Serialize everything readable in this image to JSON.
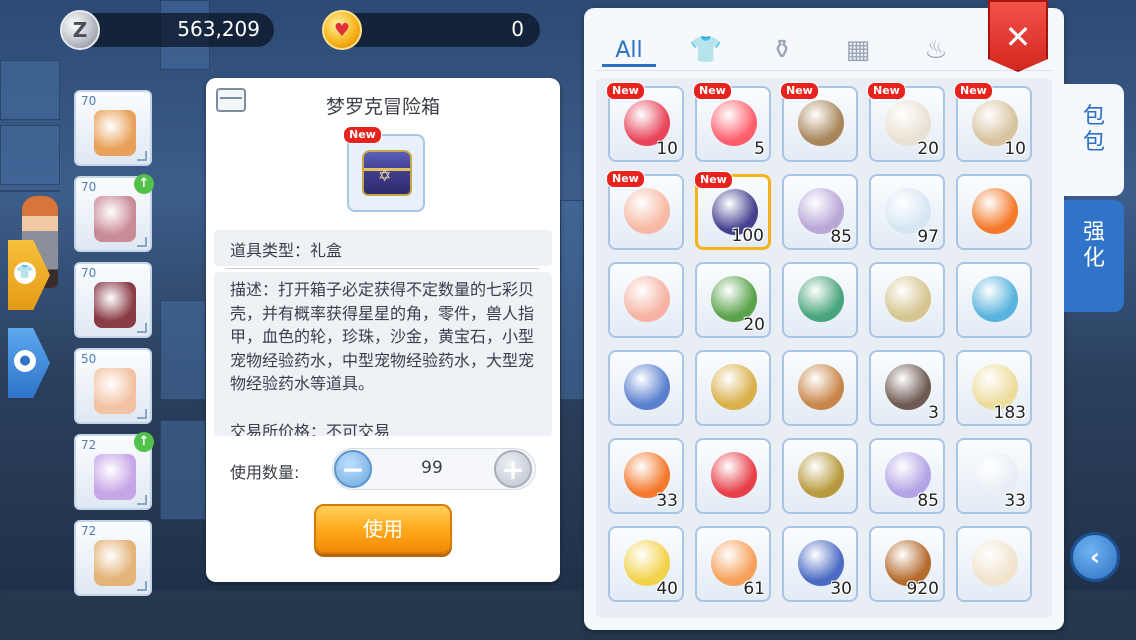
{
  "currency": {
    "zeny_icon": "Z",
    "zeny": "563,209",
    "gem_icon": "gem-coin-icon",
    "gem": "0"
  },
  "equipment_slots": [
    {
      "level": "70",
      "upgrade": false,
      "color": "#e9a15a"
    },
    {
      "level": "70",
      "upgrade": true,
      "color": "#c98b96"
    },
    {
      "level": "70",
      "upgrade": false,
      "color": "#8a3c45"
    },
    {
      "level": "50",
      "upgrade": false,
      "color": "#f3c2a3"
    },
    {
      "level": "72",
      "upgrade": true,
      "color": "#c7a6e8"
    },
    {
      "level": "72",
      "upgrade": false,
      "color": "#e3b377"
    }
  ],
  "detail": {
    "title": "梦罗克冒险箱",
    "new_label": "New",
    "type_line": "道具类型：礼盒",
    "description": "描述：打开箱子必定获得不定数量的七彩贝壳，并有概率获得星星的角，零件，兽人指甲，血色的轮，珍珠，沙金，黄宝石，小型宠物经验药水，中型宠物经验药水，大型宠物经验药水等道具。",
    "price_line": "交易所价格：不可交易",
    "quantity_label": "使用数量:",
    "quantity": "99",
    "minus": "−",
    "plus": "+",
    "use_button": "使用"
  },
  "inventory": {
    "tabs": [
      {
        "label": "All",
        "icon": "all-tab"
      },
      {
        "label": "",
        "icon": "shirt-icon"
      },
      {
        "label": "",
        "icon": "potion-bottle-icon"
      },
      {
        "label": "",
        "icon": "grid-icon"
      },
      {
        "label": "",
        "icon": "chef-hat-icon"
      }
    ],
    "new_label": "New",
    "close_label": "✕",
    "side_tabs": [
      "包\n包",
      "强\n化"
    ],
    "back_label": "‹",
    "items": [
      {
        "qty": "10",
        "new": true,
        "color": "#e8455a",
        "icon": "red-potion-icon"
      },
      {
        "qty": "5",
        "new": true,
        "color": "#ff5f6d",
        "icon": "poring-icon"
      },
      {
        "qty": "",
        "new": true,
        "color": "#a8865a",
        "icon": "coin-icon"
      },
      {
        "qty": "20",
        "new": true,
        "color": "#e9e1d3",
        "icon": "bone-icon"
      },
      {
        "qty": "10",
        "new": true,
        "color": "#d8c3a0",
        "icon": "skull-icon"
      },
      {
        "qty": "",
        "new": true,
        "color": "#f7b9a3",
        "icon": "perfume-icon"
      },
      {
        "qty": "100",
        "new": true,
        "color": "#44418f",
        "icon": "chest-icon",
        "selected": true
      },
      {
        "qty": "85",
        "new": false,
        "color": "#b9a7d8",
        "icon": "butterfly-wing-icon"
      },
      {
        "qty": "97",
        "new": false,
        "color": "#d7e6f3",
        "icon": "feather-icon"
      },
      {
        "qty": "",
        "new": false,
        "color": "#f47a2b",
        "icon": "horn-icon"
      },
      {
        "qty": "",
        "new": false,
        "color": "#f6b3a3",
        "icon": "goblet-icon"
      },
      {
        "qty": "20",
        "new": false,
        "color": "#5aa34b",
        "icon": "leaf-icon"
      },
      {
        "qty": "",
        "new": false,
        "color": "#49a57b",
        "icon": "backpack-icon"
      },
      {
        "qty": "",
        "new": false,
        "color": "#d6c58f",
        "icon": "book-icon"
      },
      {
        "qty": "",
        "new": false,
        "color": "#58b3de",
        "icon": "orb-icon"
      },
      {
        "qty": "",
        "new": false,
        "color": "#5a7fcf",
        "icon": "open-book-icon"
      },
      {
        "qty": "",
        "new": false,
        "color": "#d9b04a",
        "icon": "statue-icon"
      },
      {
        "qty": "",
        "new": false,
        "color": "#c9864a",
        "icon": "bag-icon"
      },
      {
        "qty": "3",
        "new": false,
        "color": "#6e5a52",
        "icon": "cauldron-icon"
      },
      {
        "qty": "183",
        "new": false,
        "color": "#eedc9c",
        "icon": "ticket-icon"
      },
      {
        "qty": "33",
        "new": false,
        "color": "#f4792c",
        "icon": "apple-juice-icon"
      },
      {
        "qty": "",
        "new": false,
        "color": "#e8404a",
        "icon": "candy-icon"
      },
      {
        "qty": "",
        "new": false,
        "color": "#b79a3d",
        "icon": "vase-icon"
      },
      {
        "qty": "85",
        "new": false,
        "color": "#b4a3e6",
        "icon": "violet-potion-icon"
      },
      {
        "qty": "33",
        "new": false,
        "color": "#e9eef5",
        "icon": "white-potion-icon"
      },
      {
        "qty": "40",
        "new": false,
        "color": "#f2d24a",
        "icon": "yellow-potion-icon"
      },
      {
        "qty": "61",
        "new": false,
        "color": "#f6a05a",
        "icon": "orange-potion-icon"
      },
      {
        "qty": "30",
        "new": false,
        "color": "#4a6bc4",
        "icon": "blue-ribbon-icon"
      },
      {
        "qty": "920",
        "new": false,
        "color": "#b56a2d",
        "icon": "arrow-icon"
      },
      {
        "qty": "",
        "new": false,
        "color": "#f1e3cc",
        "icon": "bunny-egg-icon"
      }
    ]
  }
}
